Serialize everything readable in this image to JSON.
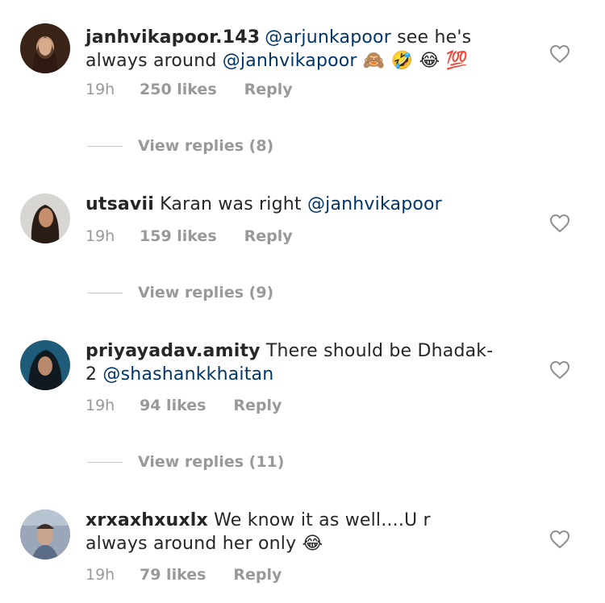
{
  "comments": [
    {
      "username": "janhvikapoor.143",
      "mention_1": "@arjunkapoor",
      "text_1": " see he's always around ",
      "mention_2": "@janhvikapoor",
      "emoji": "🙈 🤣 😂 💯",
      "time": "19h",
      "likes": "250 likes",
      "reply": "Reply",
      "view_replies": "View replies (8)",
      "avatar_colors": [
        "#3a2418",
        "#c89a7a"
      ]
    },
    {
      "username": "utsavii",
      "text_1": " Karan was right ",
      "mention_1": "@janhvikapoor",
      "time": "19h",
      "likes": "159 likes",
      "reply": "Reply",
      "view_replies": "View replies (9)",
      "avatar_colors": [
        "#d8d6d2",
        "#2a1d17"
      ]
    },
    {
      "username": "priyayadav.amity",
      "text_1": " There should be Dhadak-2 ",
      "mention_1": "@shashankkhaitan",
      "time": "19h",
      "likes": "94 likes",
      "reply": "Reply",
      "view_replies": "View replies (11)",
      "avatar_colors": [
        "#1e5c7a",
        "#b98a6d"
      ]
    },
    {
      "username": "xrxaxhxuxlx",
      "text_1": " We know it as well....U r always around her only ",
      "emoji": "😂",
      "time": "19h",
      "likes": "79 likes",
      "reply": "Reply",
      "avatar_colors": [
        "#9aa7b8",
        "#c9a48e"
      ]
    }
  ],
  "icons": {
    "like": "heart-outline-icon",
    "emoji_style": "unicode"
  },
  "colors": {
    "mention": "#003569",
    "meta": "#999999",
    "text": "#262626"
  }
}
